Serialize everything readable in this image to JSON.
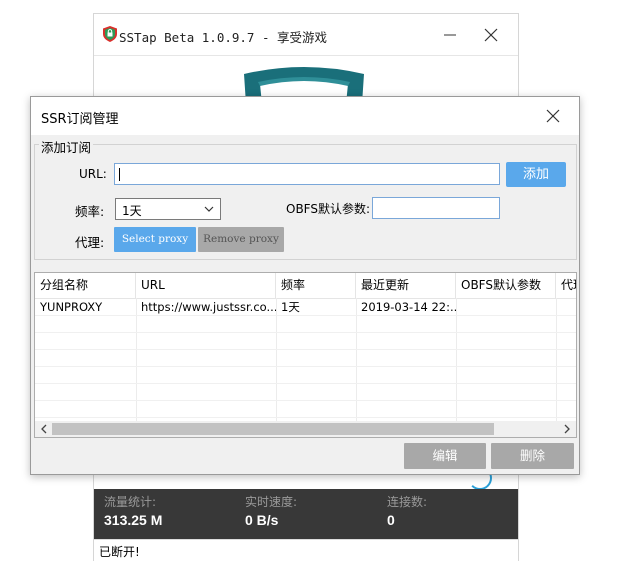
{
  "main_window": {
    "title": "SSTap Beta 1.0.9.7 - 享受游戏",
    "stats": {
      "traffic_label": "流量统计:",
      "traffic_value": "313.25 M",
      "speed_label": "实时速度:",
      "speed_value": "0 B/s",
      "connections_label": "连接数:",
      "connections_value": "0"
    },
    "status": "已断开!"
  },
  "dialog": {
    "title": "SSR订阅管理",
    "group_label": "添加订阅",
    "url_label": "URL:",
    "url_value": "",
    "add_button": "添加",
    "freq_label": "频率:",
    "freq_selected": "1天",
    "obfs_label": "OBFS默认参数:",
    "obfs_value": "",
    "proxy_label": "代理:",
    "select_proxy_button": "Select proxy",
    "remove_proxy_button": "Remove proxy",
    "table": {
      "columns": [
        "分组名称",
        "URL",
        "频率",
        "最近更新",
        "OBFS默认参数",
        "代理"
      ],
      "rows": [
        [
          "YUNPROXY",
          "https://www.justssr.co...",
          "1天",
          "2019-03-14 22:...",
          "",
          ""
        ]
      ]
    },
    "edit_button": "编辑",
    "delete_button": "删除"
  },
  "colors": {
    "accent_blue": "#5aa8eb",
    "disabled_gray": "#a8a8a8",
    "stats_bg": "#383838",
    "shield_teal": "#1a6f7a"
  },
  "icons": [
    "app-shield-icon",
    "minimize-icon",
    "close-icon",
    "chevron-down-icon",
    "scroll-left-icon",
    "scroll-right-icon"
  ]
}
